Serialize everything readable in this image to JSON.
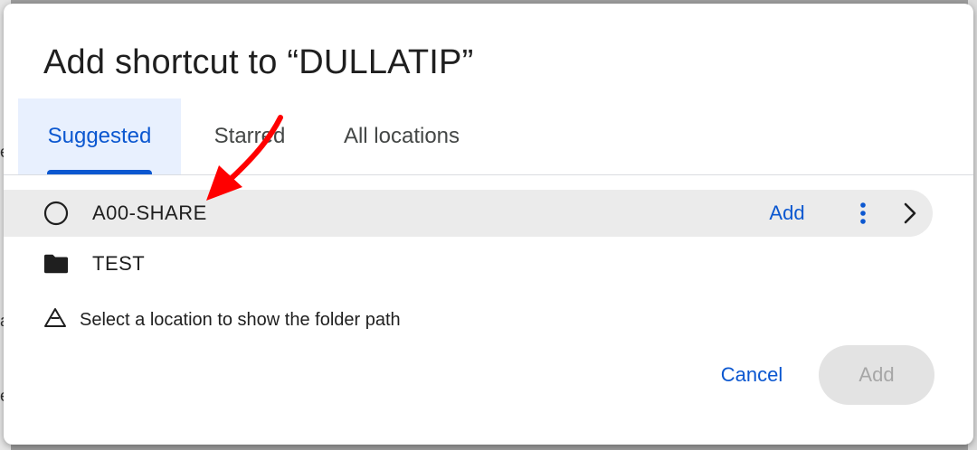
{
  "background": {
    "edge_text": [
      "e",
      "e",
      "a",
      "e"
    ]
  },
  "dialog": {
    "title": "Add shortcut to “DULLATIP”",
    "tabs": [
      {
        "label": "Suggested",
        "active": true
      },
      {
        "label": "Starred",
        "active": false
      },
      {
        "label": "All locations",
        "active": false
      }
    ],
    "rows": [
      {
        "label": "A00-SHARE",
        "icon": "shared-drive-circle-icon",
        "selected": true,
        "add_label": "Add"
      },
      {
        "label": "TEST",
        "icon": "folder-icon",
        "selected": false
      }
    ],
    "info_text": "Select a location to show the folder path",
    "cancel_label": "Cancel",
    "add_label": "Add",
    "add_enabled": false
  },
  "colors": {
    "accent": "#0b57d0",
    "active_tab_bg": "#e8f0fe",
    "selected_row_bg": "#ebebeb",
    "disabled_button_bg": "#e3e3e3",
    "annotation_arrow": "#ff0000"
  },
  "annotation": {
    "type": "red-arrow",
    "points_to": "A00-SHARE"
  }
}
